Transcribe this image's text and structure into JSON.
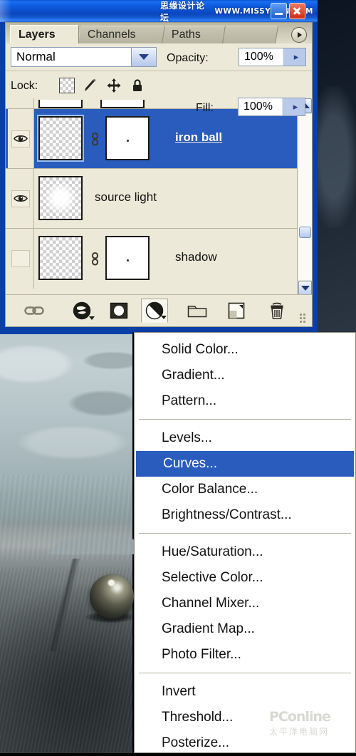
{
  "window": {
    "title": "",
    "buttons": [
      {
        "name": "minimize",
        "glyph": "–"
      },
      {
        "name": "close",
        "glyph": "×"
      }
    ],
    "watermark_cn": "思缘设计论坛",
    "watermark_url": "WWW.MISSYUAN.COM"
  },
  "panel": {
    "tabs": [
      {
        "label": "Layers",
        "active": true
      },
      {
        "label": "Channels",
        "active": false
      },
      {
        "label": "Paths",
        "active": false
      }
    ],
    "palette_menu_icon": "triangle-right-icon",
    "blend_mode": {
      "value": "Normal",
      "dropdown_icon": "chevron-down-icon"
    },
    "opacity": {
      "label": "Opacity:",
      "value": "100%",
      "stepper_icon": "chevron-right-icon"
    },
    "fill": {
      "label": "Fill:",
      "value": "100%",
      "stepper_icon": "chevron-right-icon"
    },
    "lock": {
      "label": "Lock:",
      "icons": [
        {
          "name": "lock-transparent-pixels-icon"
        },
        {
          "name": "lock-image-pixels-icon"
        },
        {
          "name": "lock-position-icon"
        },
        {
          "name": "lock-all-icon"
        }
      ]
    },
    "layers": [
      {
        "name": "iron ball",
        "visible": true,
        "selected": true,
        "has_mask": true,
        "linked": true,
        "thumb": "transparent-checker"
      },
      {
        "name": "source light",
        "visible": true,
        "selected": false,
        "has_mask": false,
        "linked": false,
        "thumb": "transparent-checker-glow"
      },
      {
        "name": "shadow",
        "visible": false,
        "selected": false,
        "has_mask": true,
        "linked": true,
        "thumb": "transparent-checker"
      }
    ],
    "scrollbar": {
      "up_icon": "chevron-up-icon",
      "down_icon": "chevron-down-icon",
      "thumb": "scroll-thumb"
    },
    "toolbar": [
      {
        "name": "link-layers-icon",
        "label": "Link layers",
        "pressed": false
      },
      {
        "name": "layer-style-fx-icon",
        "label": "Add a layer style",
        "pressed": false
      },
      {
        "name": "add-layer-mask-icon",
        "label": "Add layer mask",
        "pressed": false
      },
      {
        "name": "new-adjustment-layer-icon",
        "label": "Create new fill or adjustment layer",
        "pressed": true
      },
      {
        "name": "new-group-folder-icon",
        "label": "Create a new group",
        "pressed": false
      },
      {
        "name": "new-layer-icon",
        "label": "Create a new layer",
        "pressed": false
      },
      {
        "name": "delete-layer-trash-icon",
        "label": "Delete layer",
        "pressed": false
      }
    ]
  },
  "menu": {
    "highlighted": "Curves...",
    "groups": [
      {
        "items": [
          "Solid Color...",
          "Gradient...",
          "Pattern..."
        ]
      },
      {
        "items": [
          "Levels...",
          "Curves...",
          "Color Balance...",
          "Brightness/Contrast..."
        ]
      },
      {
        "items": [
          "Hue/Saturation...",
          "Selective Color...",
          "Channel Mixer...",
          "Gradient Map...",
          "Photo Filter..."
        ]
      },
      {
        "items": [
          "Invert",
          "Threshold...",
          "Posterize..."
        ]
      }
    ]
  },
  "canvas": {
    "description": "desert dunes with metallic sphere"
  },
  "watermark_footer": {
    "line1": "PConline",
    "line2": "太平洋电脑网"
  },
  "colors": {
    "titlebar_blue": "#0e5ee4",
    "panel_bg": "#ece9d8",
    "selection_blue": "#2a5cbe",
    "menu_bg": "#ffffff",
    "text": "#111111"
  }
}
